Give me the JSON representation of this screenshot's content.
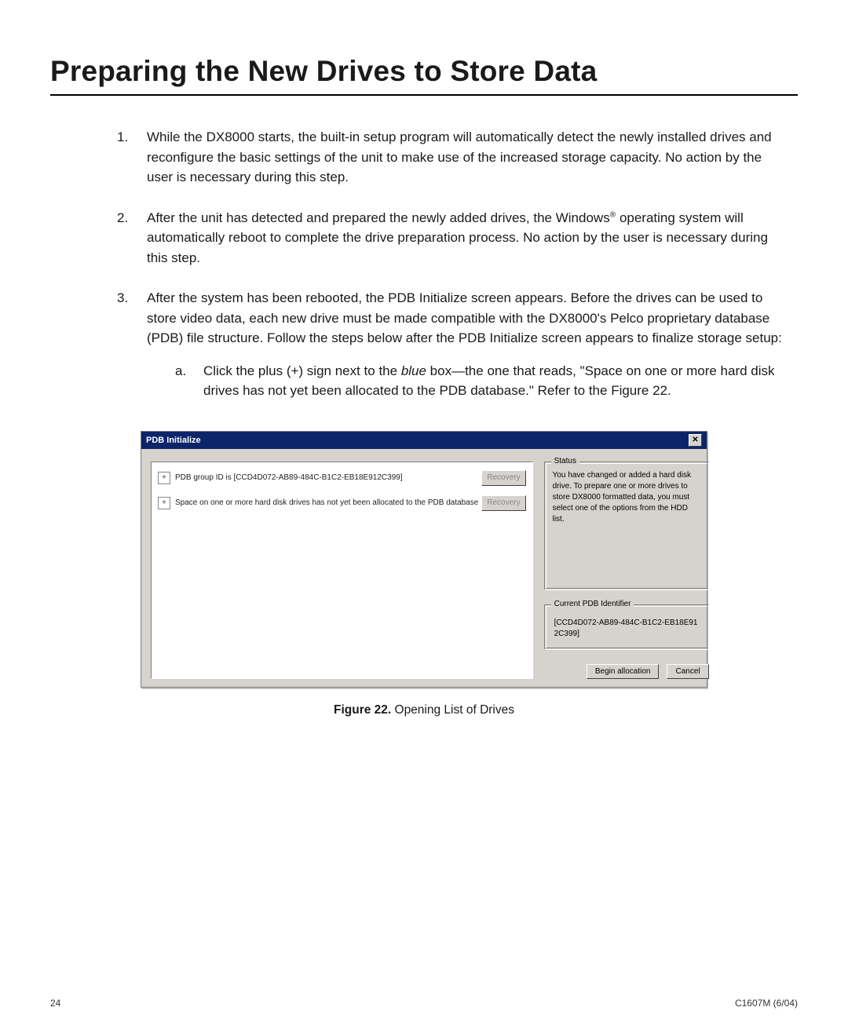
{
  "heading": "Preparing the New Drives to Store Data",
  "steps": [
    {
      "num": "1.",
      "text": "While the DX8000 starts, the built-in setup program will automatically detect the newly installed drives and reconfigure the basic settings of the unit to make use of the increased storage capacity. No action by the user is necessary during this step."
    },
    {
      "num": "2.",
      "text_pre": "After the unit has detected and prepared the newly added drives, the Windows",
      "reg": "®",
      "text_post": " operating system will automatically reboot to complete the drive preparation process. No action by the user is necessary during this step."
    },
    {
      "num": "3.",
      "text": "After the system has been rebooted, the PDB Initialize screen appears. Before the drives can be used to store video data, each new drive must be made compatible with the DX8000's Pelco proprietary database (PDB) file structure. Follow the steps below after the PDB Initialize screen appears to finalize storage setup:",
      "sub": {
        "num": "a.",
        "pre": "Click the plus (+) sign next to the ",
        "em": "blue",
        "post": " box—the one that reads, \"Space on one or more hard disk drives has not yet been allocated to the PDB database.\" Refer to the Figure 22."
      }
    }
  ],
  "dialog": {
    "title": "PDB Initialize",
    "rows": [
      {
        "text": "PDB group ID is [CCD4D072-AB89-484C-B1C2-EB18E912C399]",
        "btn": "Recovery"
      },
      {
        "text": "Space on one or more hard disk drives has not yet been allocated to the PDB database",
        "btn": "Recovery"
      }
    ],
    "status": {
      "label": "Status",
      "text": "You have changed or added a hard disk drive. To prepare one or more drives to store DX8000 formatted data, you must select one of the options from the HDD list."
    },
    "identifier": {
      "label": "Current PDB Identifier",
      "value": "[CCD4D072-AB89-484C-B1C2-EB18E912C399]"
    },
    "buttons": {
      "begin": "Begin allocation",
      "cancel": "Cancel"
    }
  },
  "figure": {
    "label": "Figure 22.",
    "caption": " Opening List of Drives"
  },
  "footer": {
    "page": "24",
    "doc": "C1607M (6/04)"
  }
}
